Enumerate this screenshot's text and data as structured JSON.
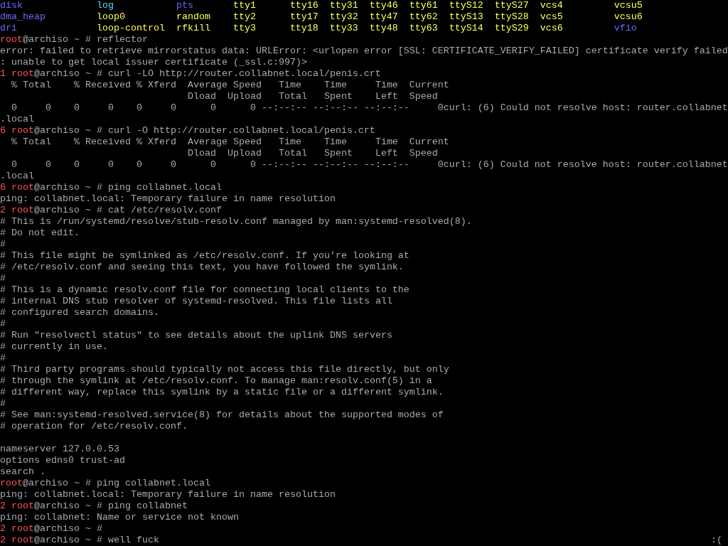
{
  "lines": [
    {
      "kind": "listing",
      "entries": [
        {
          "name": "disk",
          "color": "#6b6bff"
        },
        {
          "name": "log",
          "color": "#5fd7ff"
        },
        {
          "name": "pts",
          "color": "#6b6bff"
        },
        {
          "name": "tty1",
          "color": "#ffff55"
        },
        {
          "name": "tty16",
          "color": "#ffff55"
        },
        {
          "name": "tty31",
          "color": "#ffff55"
        },
        {
          "name": "tty46",
          "color": "#ffff55"
        },
        {
          "name": "tty61",
          "color": "#ffff55"
        },
        {
          "name": "ttyS12",
          "color": "#ffff55"
        },
        {
          "name": "ttyS27",
          "color": "#ffff55"
        },
        {
          "name": "vcs4",
          "color": "#ffff55"
        },
        {
          "name": "vcsu5",
          "color": "#ffff55"
        }
      ]
    },
    {
      "kind": "listing",
      "entries": [
        {
          "name": "dma_heap",
          "color": "#6b6bff"
        },
        {
          "name": "loop0",
          "color": "#ffff55"
        },
        {
          "name": "random",
          "color": "#ffff55"
        },
        {
          "name": "tty2",
          "color": "#ffff55"
        },
        {
          "name": "tty17",
          "color": "#ffff55"
        },
        {
          "name": "tty32",
          "color": "#ffff55"
        },
        {
          "name": "tty47",
          "color": "#ffff55"
        },
        {
          "name": "tty62",
          "color": "#ffff55"
        },
        {
          "name": "ttyS13",
          "color": "#ffff55"
        },
        {
          "name": "ttyS28",
          "color": "#ffff55"
        },
        {
          "name": "vcs5",
          "color": "#ffff55"
        },
        {
          "name": "vcsu6",
          "color": "#ffff55"
        }
      ]
    },
    {
      "kind": "listing",
      "entries": [
        {
          "name": "dri",
          "color": "#6b6bff"
        },
        {
          "name": "loop-control",
          "color": "#ffff55"
        },
        {
          "name": "rfkill",
          "color": "#ffff55"
        },
        {
          "name": "tty3",
          "color": "#ffff55"
        },
        {
          "name": "tty18",
          "color": "#ffff55"
        },
        {
          "name": "tty33",
          "color": "#ffff55"
        },
        {
          "name": "tty48",
          "color": "#ffff55"
        },
        {
          "name": "tty63",
          "color": "#ffff55"
        },
        {
          "name": "ttyS14",
          "color": "#ffff55"
        },
        {
          "name": "ttyS29",
          "color": "#ffff55"
        },
        {
          "name": "vcs6",
          "color": "#ffff55"
        },
        {
          "name": "vfio",
          "color": "#6b6bff"
        }
      ]
    },
    {
      "kind": "prompt",
      "user": "root",
      "host": "@archiso ~ #",
      "command": "reflector"
    },
    {
      "kind": "output",
      "text": "error: failed to retrieve mirrorstatus data: URLError: <urlopen error [SSL: CERTIFICATE_VERIFY_FAILED] certificate verify failed"
    },
    {
      "kind": "output",
      "text": ": unable to get local issuer certificate (_ssl.c:997)>"
    },
    {
      "kind": "prompt",
      "status": "1",
      "user": "root",
      "host": "@archiso ~ #",
      "command": "curl -LO http://router.collabnet.local/penis.crt"
    },
    {
      "kind": "output",
      "text": "  % Total    % Received % Xferd  Average Speed   Time    Time     Time  Current"
    },
    {
      "kind": "output",
      "text": "                                 Dload  Upload   Total   Spent    Left  Speed"
    },
    {
      "kind": "output",
      "text": "  0     0    0     0    0     0      0      0 --:--:-- --:--:-- --:--:--     0curl: (6) Could not resolve host: router.collabnet"
    },
    {
      "kind": "output",
      "text": ".local"
    },
    {
      "kind": "prompt",
      "status": "6",
      "user": "root",
      "host": "@archiso ~ #",
      "command": "curl -O http://router.collabnet.local/penis.crt"
    },
    {
      "kind": "output",
      "text": "  % Total    % Received % Xferd  Average Speed   Time    Time     Time  Current"
    },
    {
      "kind": "output",
      "text": "                                 Dload  Upload   Total   Spent    Left  Speed"
    },
    {
      "kind": "output",
      "text": "  0     0    0     0    0     0      0      0 --:--:-- --:--:-- --:--:--     0curl: (6) Could not resolve host: router.collabnet"
    },
    {
      "kind": "output",
      "text": ".local"
    },
    {
      "kind": "prompt",
      "status": "6",
      "user": "root",
      "host": "@archiso ~ #",
      "command": "ping collabnet.local"
    },
    {
      "kind": "output",
      "text": "ping: collabnet.local: Temporary failure in name resolution"
    },
    {
      "kind": "prompt",
      "status": "2",
      "user": "root",
      "host": "@archiso ~ #",
      "command": "cat /etc/resolv.conf"
    },
    {
      "kind": "output",
      "text": "# This is /run/systemd/resolve/stub-resolv.conf managed by man:systemd-resolved(8)."
    },
    {
      "kind": "output",
      "text": "# Do not edit."
    },
    {
      "kind": "output",
      "text": "#"
    },
    {
      "kind": "output",
      "text": "# This file might be symlinked as /etc/resolv.conf. If you’re looking at"
    },
    {
      "kind": "output",
      "text": "# /etc/resolv.conf and seeing this text, you have followed the symlink."
    },
    {
      "kind": "output",
      "text": "#"
    },
    {
      "kind": "output",
      "text": "# This is a dynamic resolv.conf file for connecting local clients to the"
    },
    {
      "kind": "output",
      "text": "# internal DNS stub resolver of systemd-resolved. This file lists all"
    },
    {
      "kind": "output",
      "text": "# configured search domains."
    },
    {
      "kind": "output",
      "text": "#"
    },
    {
      "kind": "output",
      "text": "# Run \"resolvectl status\" to see details about the uplink DNS servers"
    },
    {
      "kind": "output",
      "text": "# currently in use."
    },
    {
      "kind": "output",
      "text": "#"
    },
    {
      "kind": "output",
      "text": "# Third party programs should typically not access this file directly, but only"
    },
    {
      "kind": "output",
      "text": "# through the symlink at /etc/resolv.conf. To manage man:resolv.conf(5) in a"
    },
    {
      "kind": "output",
      "text": "# different way, replace this symlink by a static file or a different symlink."
    },
    {
      "kind": "output",
      "text": "#"
    },
    {
      "kind": "output",
      "text": "# See man:systemd-resolved.service(8) for details about the supported modes of"
    },
    {
      "kind": "output",
      "text": "# operation for /etc/resolv.conf."
    },
    {
      "kind": "blank"
    },
    {
      "kind": "output",
      "text": "nameserver 127.0.0.53"
    },
    {
      "kind": "output",
      "text": "options edns0 trust-ad"
    },
    {
      "kind": "output",
      "text": "search ."
    },
    {
      "kind": "prompt",
      "user": "root",
      "host": "@archiso ~ #",
      "command": "ping collabnet.local"
    },
    {
      "kind": "output",
      "text": "ping: collabnet.local: Temporary failure in name resolution"
    },
    {
      "kind": "prompt",
      "status": "2",
      "user": "root",
      "host": "@archiso ~ #",
      "command": "ping collabnet"
    },
    {
      "kind": "output",
      "text": "ping: collabnet: Name or service not known"
    },
    {
      "kind": "prompt",
      "status": "2",
      "user": "root",
      "host": "@archiso ~ #"
    },
    {
      "kind": "prompt",
      "status": "2",
      "user": "root",
      "host": "@archiso ~ #",
      "command": "well fuck",
      "rprompt": ":("
    }
  ]
}
